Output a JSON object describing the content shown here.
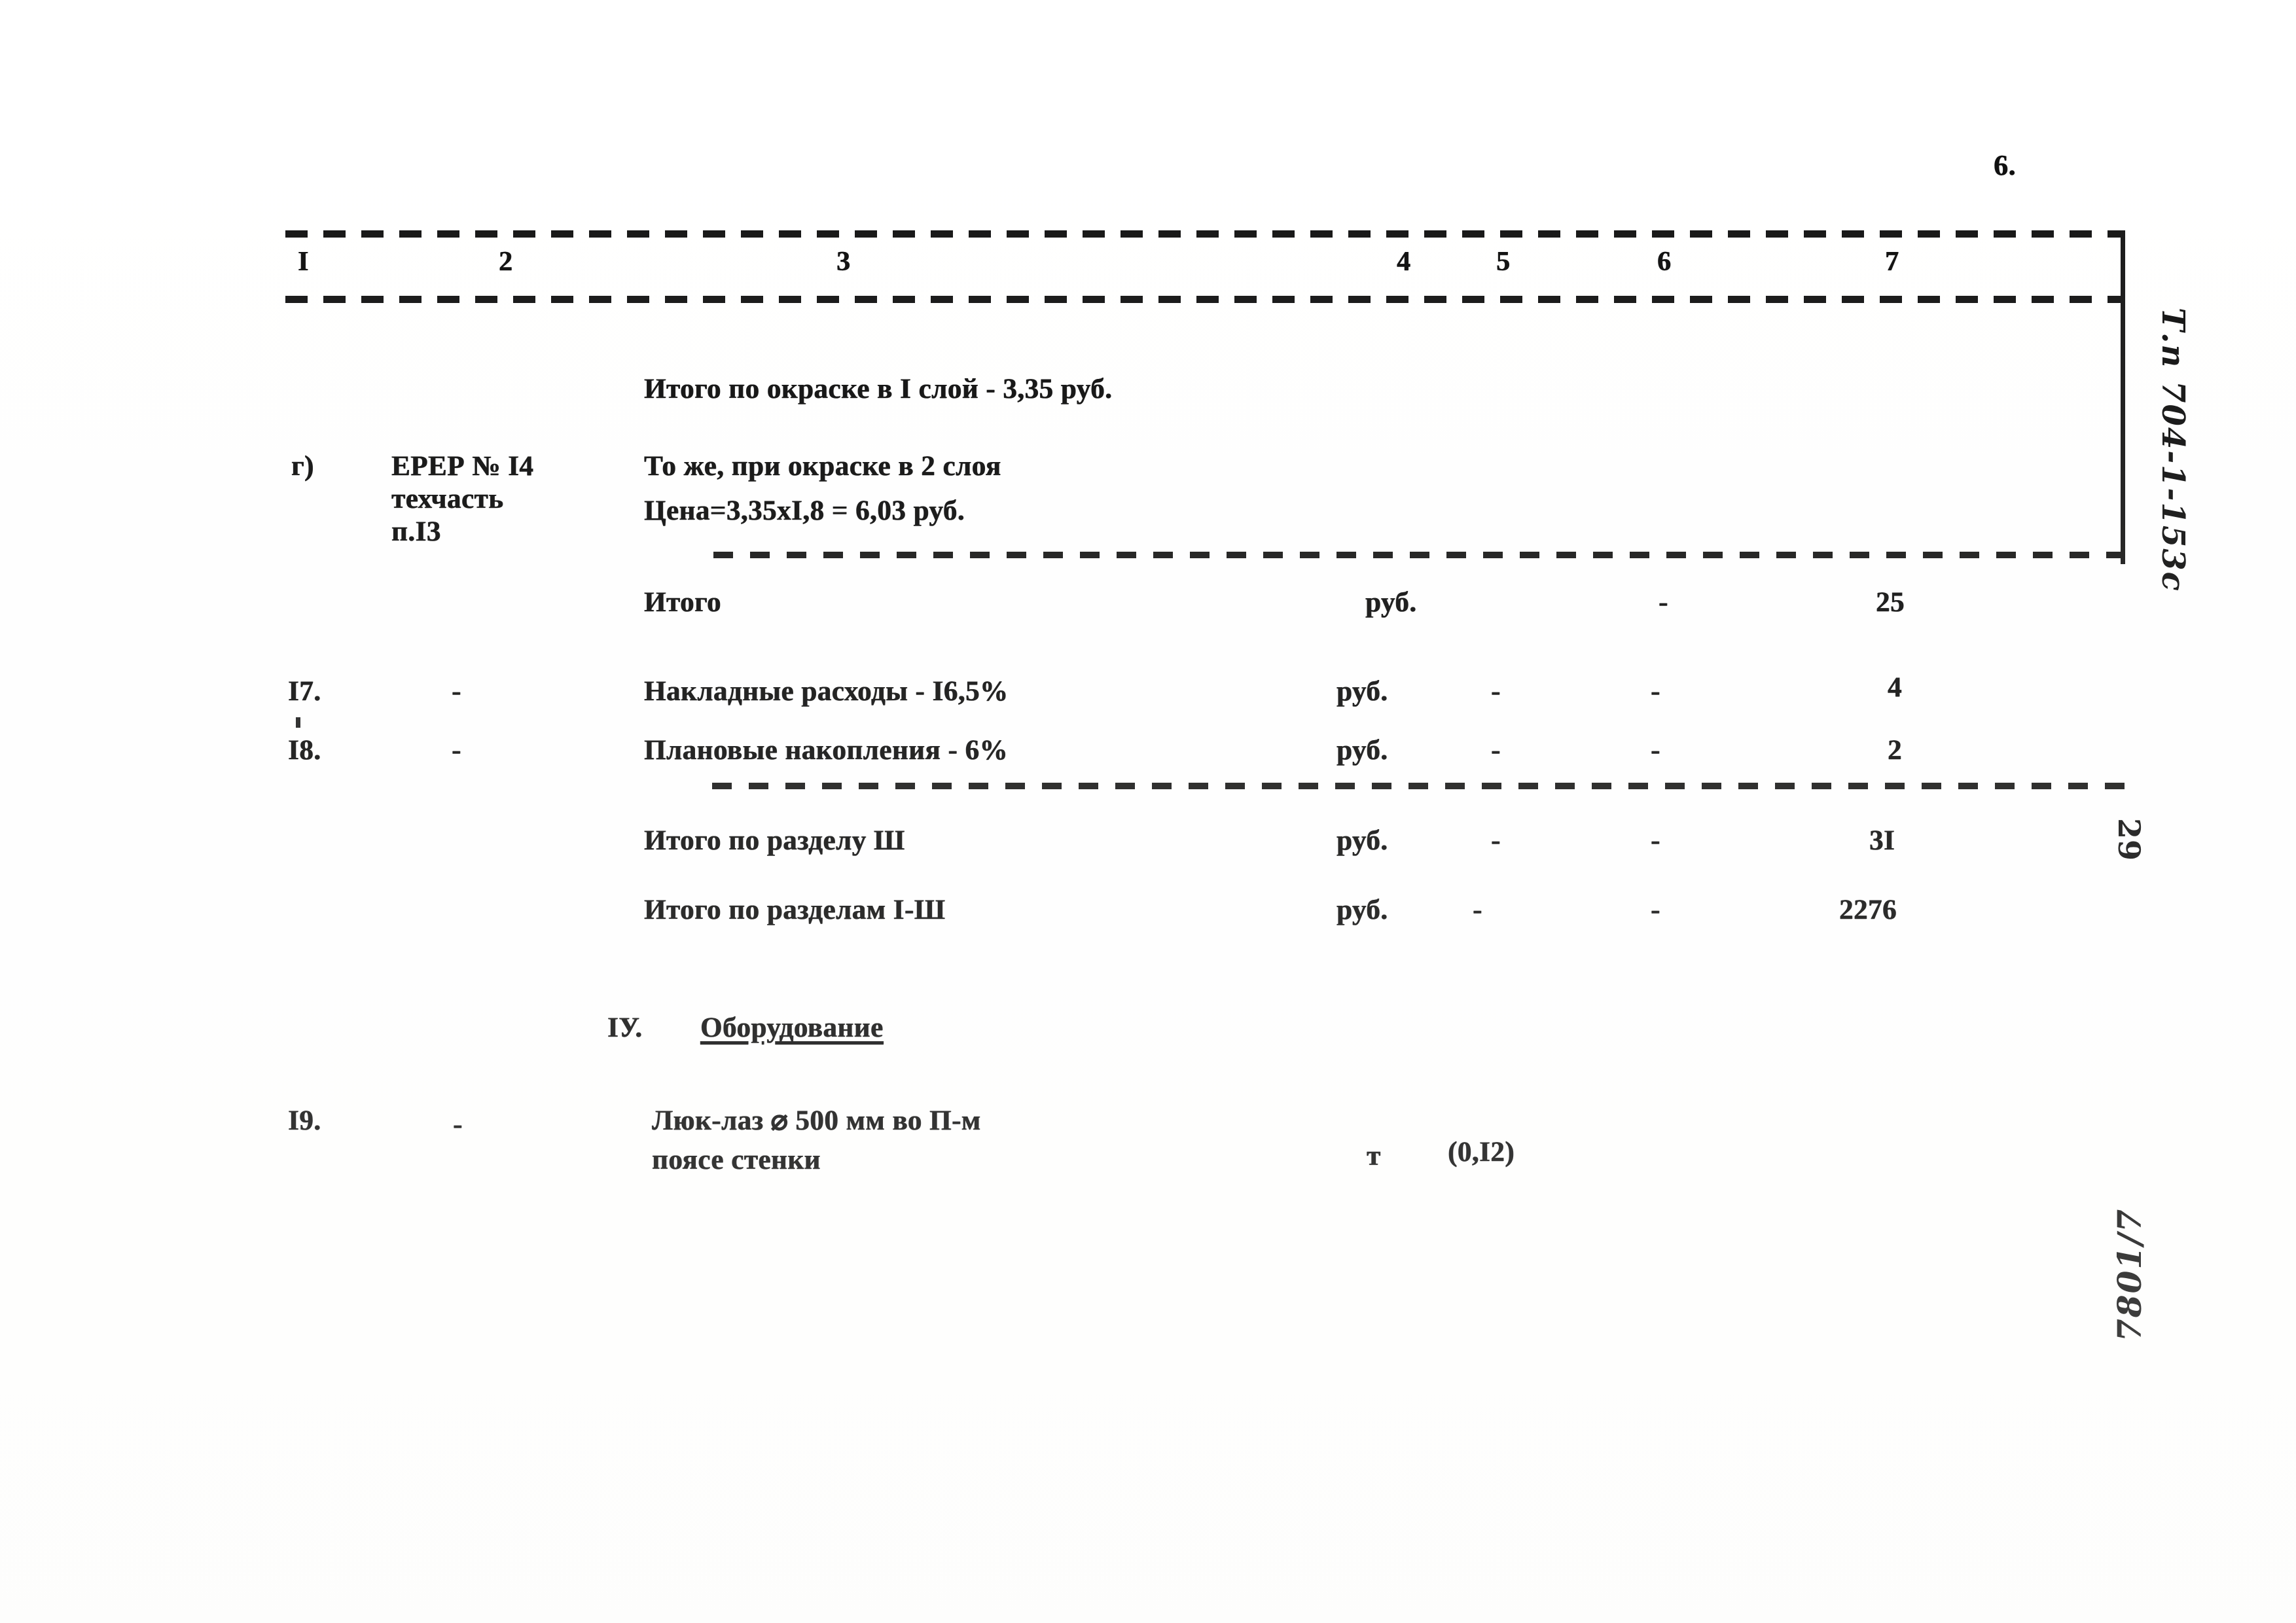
{
  "document": {
    "page_number": "6.",
    "language": "ru"
  },
  "table": {
    "column_headers": [
      "I",
      "2",
      "3",
      "4",
      "5",
      "6",
      "7"
    ],
    "rows": [
      {
        "id": "row-itogo-okraska-1sloy",
        "col1": "",
        "col2": "",
        "col3": "Итого по окраске в I слой - 3,35 руб.",
        "col4": "",
        "col5": "",
        "col6": "",
        "col7": ""
      },
      {
        "id": "row-g-erer-14",
        "col1": "г)",
        "col2_line1": "ЕРЕР № I4",
        "col2_line2": "техчасть",
        "col2_line3": "п.I3",
        "col3_line1": "То же, при окраске в 2 слоя",
        "col3_line2": "Цена=3,35хI,8 = 6,03 руб.",
        "col4": "",
        "col5": "",
        "col6": "",
        "col7": ""
      },
      {
        "id": "row-itogo",
        "col1": "",
        "col2": "",
        "col3": "Итого",
        "col4": "руб.",
        "col5": "",
        "col6": "-",
        "col7": "25"
      },
      {
        "id": "row-17-nakladnye",
        "col1": "I7.",
        "col2": "-",
        "col3": "Накладные расходы - I6,5%",
        "col4": "руб.",
        "col5": "-",
        "col6": "-",
        "col7": "4"
      },
      {
        "id": "row-18-planovye",
        "col1": "I8.",
        "col2": "-",
        "col3": "Плановые накопления - 6%",
        "col4": "руб.",
        "col5": "-",
        "col6": "-",
        "col7": "2"
      },
      {
        "id": "row-itogo-razdel-3",
        "col1": "",
        "col2": "",
        "col3": "Итого по разделу Ш",
        "col4": "руб.",
        "col5": "-",
        "col6": "-",
        "col7": "3I"
      },
      {
        "id": "row-itogo-razdely-1-3",
        "col1": "",
        "col2": "",
        "col3": "Итого по разделам I-Ш",
        "col4": "руб.",
        "col5": "-",
        "col6": "-",
        "col7": "2276"
      },
      {
        "id": "row-19-luk-laz",
        "col1": "I9.",
        "col2": "-",
        "col3_line1": "Люк-лаз ⌀ 500 мм во П-м",
        "col3_line2": "поясе стенки",
        "col4": "т",
        "col5": "(0,I2)",
        "col6": "",
        "col7": ""
      }
    ]
  },
  "section_heading": {
    "numeral": "IУ.",
    "title": "Оборудование"
  },
  "margin_notes": {
    "project_code": "Т.п 704-1-153с",
    "sheet_number": "29",
    "archive_code": "7801/7"
  }
}
